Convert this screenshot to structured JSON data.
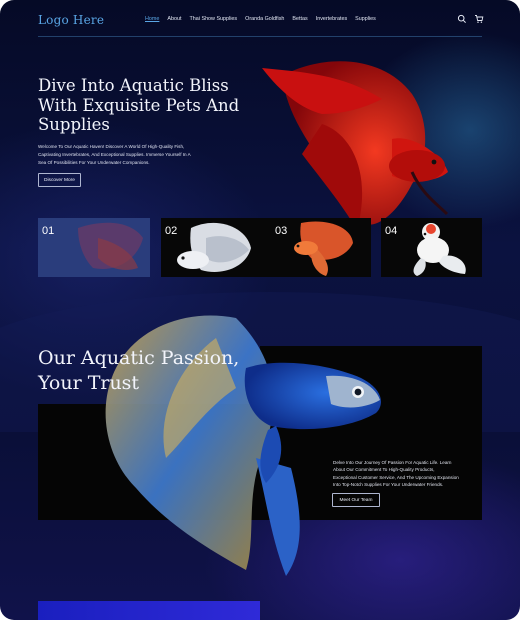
{
  "header": {
    "logo": "Logo Here",
    "nav": [
      "Home",
      "About",
      "Thai Show Supplies",
      "Oranda Goldfish",
      "Bettas",
      "Invertebrates",
      "Supplies"
    ],
    "icons": [
      "search-icon",
      "cart-icon"
    ]
  },
  "hero": {
    "title_lines": [
      "Dive Into Aquatic Bliss",
      "With Exquisite Pets And",
      "Supplies"
    ],
    "text_lines": [
      "Welcome To Our Aquatic Haven! Discover A World Of High-Quality Fish,",
      "Captivating Invertebrates, And Exceptional Supplies. Immerse Yourself In A",
      "Sea Of Possibilities For Your Underwater Companions."
    ],
    "button": "Discover More"
  },
  "gallery": [
    "01",
    "02",
    "03",
    "04"
  ],
  "passion": {
    "title_lines": [
      "Our Aquatic Passion,",
      "Your Trust"
    ],
    "text_lines": [
      "Delve Into Our Journey Of Passion For Aquatic Life. Learn",
      "About Our Commitment To High-Quality Products,",
      "Exceptional Customer Service, And The Upcoming Expansion",
      "Into Top-Notch Supplies For Your Underwater Friends."
    ],
    "button": "Meet Our Team"
  },
  "colors": {
    "accent": "#5aa6e6",
    "background": "#0b1240"
  }
}
